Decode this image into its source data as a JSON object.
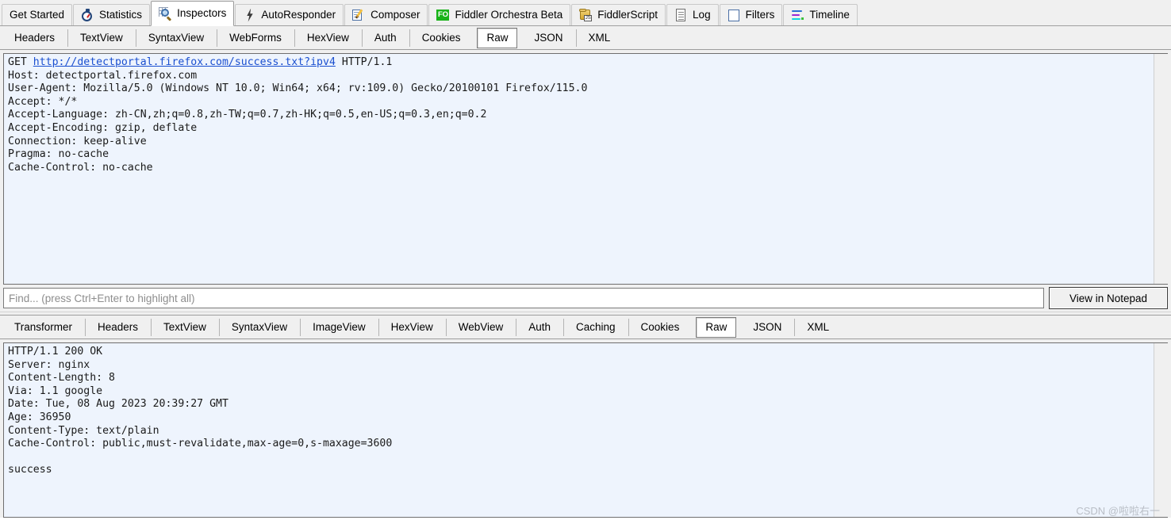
{
  "main_tabs": [
    {
      "label": "Get Started",
      "icon": "none",
      "active": false
    },
    {
      "label": "Statistics",
      "icon": "stopwatch-icon",
      "active": false
    },
    {
      "label": "Inspectors",
      "icon": "magnifier-icon",
      "active": true
    },
    {
      "label": "AutoResponder",
      "icon": "lightning-bolt-icon",
      "active": false
    },
    {
      "label": "Composer",
      "icon": "notepad-pencil-icon",
      "active": false
    },
    {
      "label": "Fiddler Orchestra Beta",
      "icon": "fo-badge-icon",
      "active": false
    },
    {
      "label": "FiddlerScript",
      "icon": "script-scroll-icon",
      "active": false
    },
    {
      "label": "Log",
      "icon": "log-document-icon",
      "active": false
    },
    {
      "label": "Filters",
      "icon": "filter-square-icon",
      "active": false
    },
    {
      "label": "Timeline",
      "icon": "timeline-bars-icon",
      "active": false
    }
  ],
  "request": {
    "tabs": [
      {
        "label": "Headers",
        "selected": false
      },
      {
        "label": "TextView",
        "selected": false
      },
      {
        "label": "SyntaxView",
        "selected": false
      },
      {
        "label": "WebForms",
        "selected": false
      },
      {
        "label": "HexView",
        "selected": false
      },
      {
        "label": "Auth",
        "selected": false
      },
      {
        "label": "Cookies",
        "selected": false
      },
      {
        "label": "Raw",
        "selected": true
      },
      {
        "label": "JSON",
        "selected": false
      },
      {
        "label": "XML",
        "selected": false
      }
    ],
    "request_line": {
      "method": "GET",
      "url": "http://detectportal.firefox.com/success.txt?ipv4",
      "version": "HTTP/1.1"
    },
    "headers_text": "Host: detectportal.firefox.com\nUser-Agent: Mozilla/5.0 (Windows NT 10.0; Win64; x64; rv:109.0) Gecko/20100101 Firefox/115.0\nAccept: */*\nAccept-Language: zh-CN,zh;q=0.8,zh-TW;q=0.7,zh-HK;q=0.5,en-US;q=0.3,en;q=0.2\nAccept-Encoding: gzip, deflate\nConnection: keep-alive\nPragma: no-cache\nCache-Control: no-cache"
  },
  "find": {
    "placeholder": "Find... (press Ctrl+Enter to highlight all)",
    "value": ""
  },
  "view_in_notepad_label": "View in Notepad",
  "response": {
    "tabs": [
      {
        "label": "Transformer",
        "selected": false
      },
      {
        "label": "Headers",
        "selected": false
      },
      {
        "label": "TextView",
        "selected": false
      },
      {
        "label": "SyntaxView",
        "selected": false
      },
      {
        "label": "ImageView",
        "selected": false
      },
      {
        "label": "HexView",
        "selected": false
      },
      {
        "label": "WebView",
        "selected": false
      },
      {
        "label": "Auth",
        "selected": false
      },
      {
        "label": "Caching",
        "selected": false
      },
      {
        "label": "Cookies",
        "selected": false
      },
      {
        "label": "Raw",
        "selected": true
      },
      {
        "label": "JSON",
        "selected": false
      },
      {
        "label": "XML",
        "selected": false
      }
    ],
    "raw_text": "HTTP/1.1 200 OK\nServer: nginx\nContent-Length: 8\nVia: 1.1 google\nDate: Tue, 08 Aug 2023 20:39:27 GMT\nAge: 36950\nContent-Type: text/plain\nCache-Control: public,must-revalidate,max-age=0,s-maxage=3600\n\nsuccess"
  },
  "watermark": "CSDN @啦啦右一",
  "colors": {
    "chrome": "#f0f0f0",
    "text_area_bg": "#eef4fd",
    "link": "#1a4fd0",
    "accent_green": "#19b319"
  }
}
